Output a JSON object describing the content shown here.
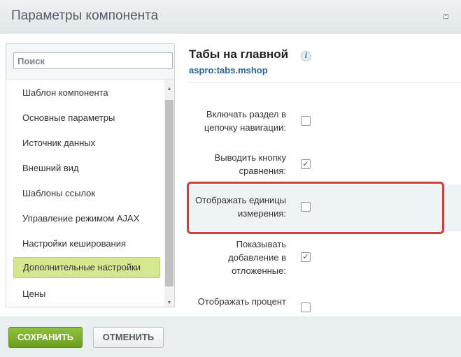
{
  "window": {
    "title": "Параметры компонента"
  },
  "search": {
    "placeholder": "Поиск"
  },
  "sidebar": {
    "items": [
      {
        "label": "Шаблон компонента"
      },
      {
        "label": "Основные параметры"
      },
      {
        "label": "Источник данных"
      },
      {
        "label": "Внешний вид"
      },
      {
        "label": "Шаблоны ссылок"
      },
      {
        "label": "Управление режимом AJAX"
      },
      {
        "label": "Настройки кеширования"
      },
      {
        "label": "Дополнительные настройки",
        "active": true
      },
      {
        "label": "Цены"
      }
    ]
  },
  "component": {
    "title": "Табы на главной",
    "code": "aspro:tabs.mshop",
    "info_icon": "info-icon"
  },
  "options": [
    {
      "line1": "Включать раздел в",
      "line2": "цепочку навигации:",
      "checked": false
    },
    {
      "line1": "Выводить кнопку",
      "line2": "сравнения:",
      "checked": true
    },
    {
      "line1": "Отображать единицы",
      "line2": "измерения:",
      "checked": false
    },
    {
      "line1": "Показывать",
      "line2": "добавление в",
      "line3": "отложенные:",
      "checked": true
    },
    {
      "line1": "Отображать процент",
      "checked": false
    }
  ],
  "footer": {
    "save_label": "СОХРАНИТЬ",
    "cancel_label": "ОТМЕНИТЬ"
  },
  "colors": {
    "save": "#6fa123",
    "active_item": "#d5e88f",
    "highlight_border": "#d13f3f",
    "link": "#2a6496"
  }
}
